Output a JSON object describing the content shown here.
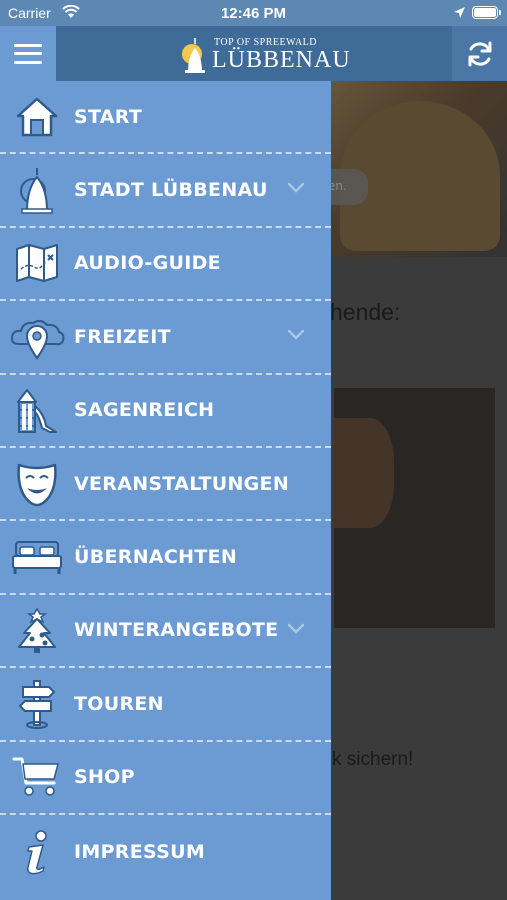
{
  "status_bar": {
    "carrier": "Carrier",
    "time": "12:46 PM"
  },
  "header": {
    "logo_top": "TOP OF SPREEWALD",
    "logo_name": "LÜBBENAU"
  },
  "background": {
    "hero_caption": "en.",
    "heading": "hende:",
    "cta": "k sichern!"
  },
  "menu": {
    "items": [
      {
        "label": "START",
        "icon": "house-icon",
        "has_children": false
      },
      {
        "label": "STADT LÜBBENAU",
        "icon": "bell-tower-icon",
        "has_children": true
      },
      {
        "label": "AUDIO-GUIDE",
        "icon": "map-icon",
        "has_children": false
      },
      {
        "label": "FREIZEIT",
        "icon": "cloud-pin-icon",
        "has_children": true
      },
      {
        "label": "SAGENREICH",
        "icon": "playground-icon",
        "has_children": false
      },
      {
        "label": "VERANSTALTUNGEN",
        "icon": "theater-mask-icon",
        "has_children": false
      },
      {
        "label": "ÜBERNACHTEN",
        "icon": "bed-icon",
        "has_children": false
      },
      {
        "label": "WINTERANGEBOTE",
        "icon": "christmas-tree-icon",
        "has_children": true
      },
      {
        "label": "TOUREN",
        "icon": "signpost-icon",
        "has_children": false
      },
      {
        "label": "SHOP",
        "icon": "shopping-cart-icon",
        "has_children": false
      },
      {
        "label": "IMPRESSUM",
        "icon": "info-icon",
        "has_children": false
      }
    ]
  },
  "colors": {
    "drawer_bg": "#6b9bd2",
    "header_bg": "#3f6b99",
    "icon_outline": "#2f5a8a"
  }
}
